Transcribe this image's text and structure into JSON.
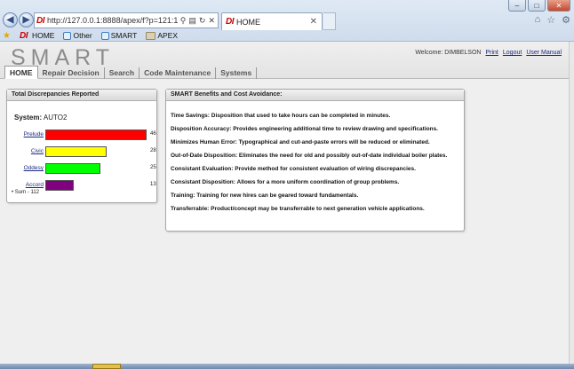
{
  "browser": {
    "url": "http://127.0.0.1:8888/apex/f?p=121:1:566699184",
    "tab_title": "HOME",
    "favorites": [
      {
        "label": "HOME",
        "icon": "di-logo-icon"
      },
      {
        "label": "Other",
        "icon": "page-icon"
      },
      {
        "label": "SMART",
        "icon": "page-icon"
      },
      {
        "label": "APEX",
        "icon": "folder-icon"
      }
    ]
  },
  "app": {
    "logo": "SMART",
    "user": {
      "welcome": "Welcome: DIMBELSON",
      "links": [
        "Print",
        "Logout",
        "User Manual"
      ]
    },
    "nav": [
      "HOME",
      "Repair Decision",
      "Search",
      "Code Maintenance",
      "Systems"
    ],
    "discrepancies": {
      "title": "Total Discrepancies Reported",
      "system_label": "System:",
      "system_value": "AUTO2",
      "sum_label": "Sum - 112"
    },
    "benefits": {
      "title": "SMART Benefits and Cost Avoidance:",
      "items": [
        "Time Savings: Disposition that used to take hours can be completed in minutes.",
        "Disposition Accuracy: Provides engineering additional time to review drawing and specifications.",
        "Minimizes Human Error: Typographical and cut-and-paste errors will be reduced or eliminated.",
        "Out-of-Date Disposition: Eliminates the need for old and possibly out-of-date individual boiler plates.",
        "Consistant Evaluation: Provide method for consistent evaluation of wiring discrepancies.",
        "Consistant Disposition: Allows for a more uniform coordination of group problems.",
        "Training: Training for new hires can be geared toward fundamentals.",
        "Transferrable: Product/concept may be transferrable to next generation vehicle applications."
      ]
    }
  },
  "chart_data": {
    "type": "bar",
    "orientation": "horizontal",
    "categories": [
      "Prelude",
      "Civic",
      "Oddesy",
      "Accord"
    ],
    "values": [
      46,
      28,
      25,
      13
    ],
    "colors": [
      "#ff0000",
      "#ffff00",
      "#00ff00",
      "#800080"
    ]
  }
}
